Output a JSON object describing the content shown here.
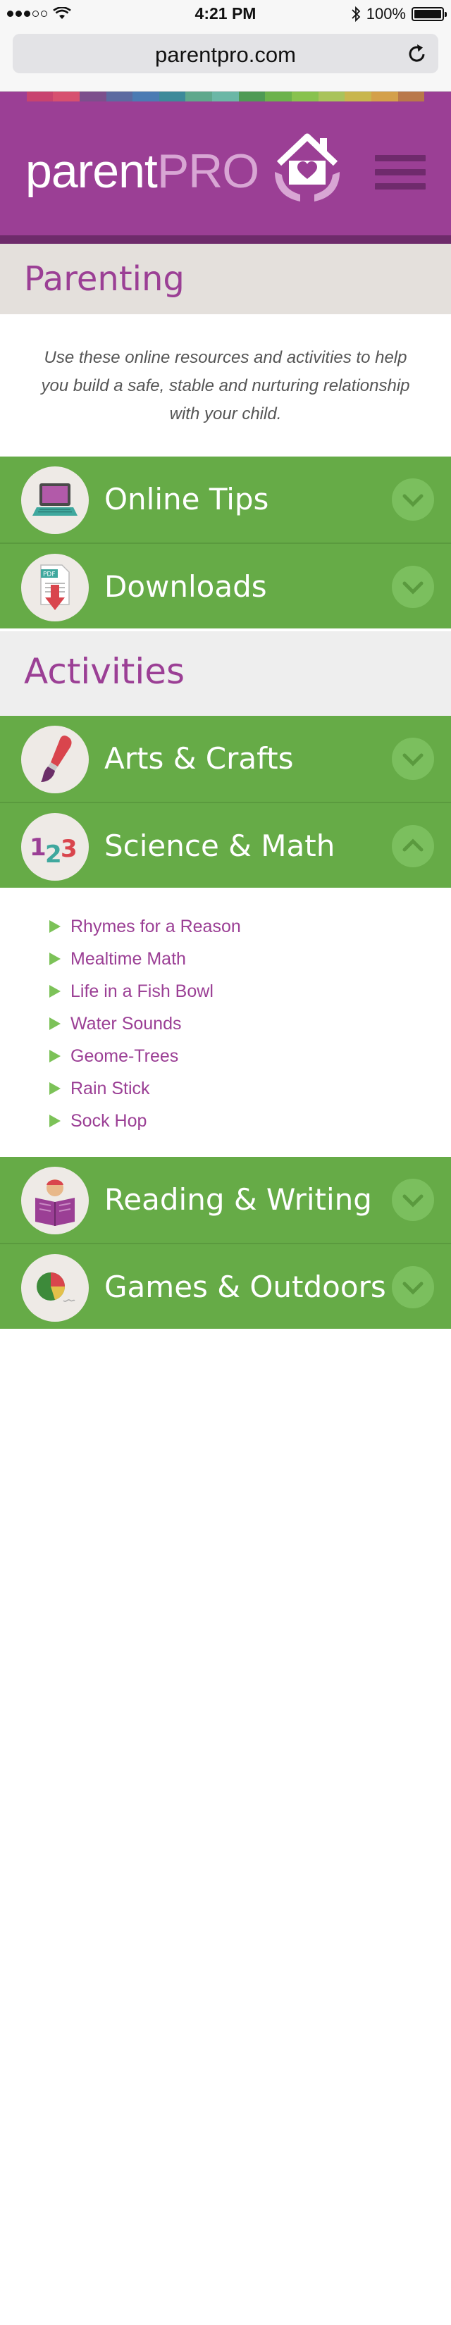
{
  "status_bar": {
    "time": "4:21 PM",
    "battery_percent": "100%",
    "battery_level": 1.0
  },
  "browser": {
    "url": "parentpro.com"
  },
  "header": {
    "logo_main": "parent",
    "logo_accent": "PRO",
    "stripe_colors": [
      "#9b3f95",
      "#c8436f",
      "#d7506f",
      "#7c4f8c",
      "#5c6aa0",
      "#4b7bb3",
      "#3d8a9a",
      "#5fa88c",
      "#6bb7a6",
      "#4f9a55",
      "#6cb24c",
      "#88c24e",
      "#a9c35b",
      "#c8b64e",
      "#d4a04a",
      "#b9784a",
      "#9b3f95"
    ],
    "menu_icon": "hamburger-icon"
  },
  "parenting": {
    "title": "Parenting",
    "intro": "Use these online resources and activities to help you build a safe, stable and nurturing relationship with your child."
  },
  "resources": [
    {
      "label": "Online Tips",
      "icon": "laptop-icon",
      "expanded": false
    },
    {
      "label": "Downloads",
      "icon": "pdf-download-icon",
      "expanded": false
    }
  ],
  "activities": {
    "title": "Activities",
    "items": [
      {
        "label": "Arts & Crafts",
        "icon": "paintbrush-icon",
        "expanded": false
      },
      {
        "label": "Science & Math",
        "icon": "numbers-icon",
        "expanded": true
      },
      {
        "label": "Reading & Writing",
        "icon": "reading-icon",
        "expanded": false
      },
      {
        "label": "Games & Outdoors",
        "icon": "ball-icon",
        "expanded": false
      }
    ],
    "science_math_links": [
      "Rhymes for a Reason",
      "Mealtime Math",
      "Life in a Fish Bowl",
      "Water Sounds",
      "Geome-Trees",
      "Rain Stick",
      "Sock Hop"
    ]
  }
}
